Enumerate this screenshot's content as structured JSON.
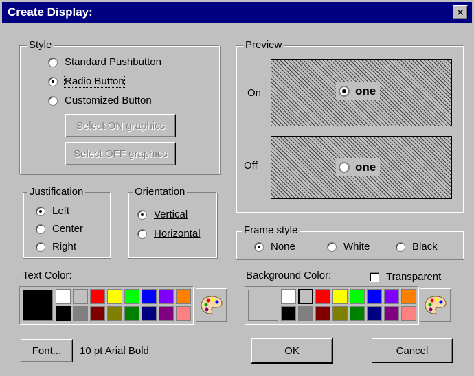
{
  "window": {
    "title": "Create Display:",
    "close_glyph": "✕"
  },
  "style_group": {
    "legend": "Style",
    "options": [
      {
        "label": "Standard Pushbutton",
        "checked": false
      },
      {
        "label": "Radio Button",
        "checked": true
      },
      {
        "label": "Customized Button",
        "checked": false
      }
    ],
    "select_on": "Select ON graphics",
    "select_off": "Select OFF graphics"
  },
  "preview_group": {
    "legend": "Preview",
    "on_label": "On",
    "off_label": "Off",
    "button_text": "one"
  },
  "justification_group": {
    "legend": "Justification",
    "options": [
      {
        "label": "Left",
        "checked": true
      },
      {
        "label": "Center",
        "checked": false
      },
      {
        "label": "Right",
        "checked": false
      }
    ]
  },
  "orientation_group": {
    "legend": "Orientation",
    "options": [
      {
        "label": "Vertical",
        "checked": true
      },
      {
        "label": "Horizontal",
        "checked": false
      }
    ]
  },
  "frame_group": {
    "legend": "Frame style",
    "options": [
      {
        "label": "None",
        "checked": true
      },
      {
        "label": "White",
        "checked": false
      },
      {
        "label": "Black",
        "checked": false
      }
    ]
  },
  "text_color": {
    "label": "Text Color:",
    "current": "#000000",
    "selected_index": 8,
    "icon": "palette-icon"
  },
  "background_color": {
    "label": "Background Color:",
    "current": "#c0c0c0",
    "selected_index": 1,
    "icon": "palette-icon",
    "transparent_label": "Transparent",
    "transparent_checked": false
  },
  "palette_colors": [
    "#ffffff",
    "#c0c0c0",
    "#ff0000",
    "#ffff00",
    "#00ff00",
    "#0000ff",
    "#8000ff",
    "#ff8000",
    "#000000",
    "#808080",
    "#800000",
    "#808000",
    "#008000",
    "#000080",
    "#800080",
    "#ff8080"
  ],
  "font": {
    "button": "Font...",
    "description": "10 pt Arial Bold"
  },
  "ok_label": "OK",
  "cancel_label": "Cancel"
}
